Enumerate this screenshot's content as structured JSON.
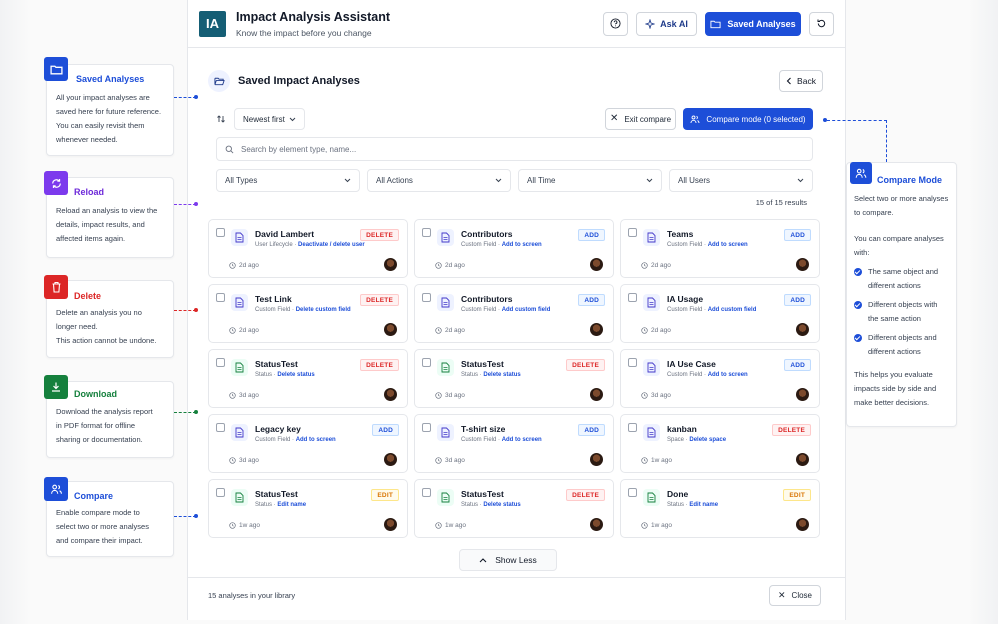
{
  "colors": {
    "primary": "#1d4ed8",
    "delete": "#dc2626",
    "download": "#15803d",
    "reload": "#7c3aed",
    "logo": "#155e75"
  },
  "header": {
    "logo_text": "IA",
    "title": "Impact Analysis Assistant",
    "subtitle": "Know the impact before you change",
    "ask_ai_label": "Ask AI",
    "saved_analyses_label": "Saved Analyses"
  },
  "panel": {
    "title": "Saved Impact Analyses",
    "back_label": "Back",
    "sort_label": "Newest first",
    "exit_compare_label": "Exit compare",
    "compare_mode_label": "Compare mode (0 selected)",
    "search_placeholder": "Search by element type, name...",
    "filters": [
      "All Types",
      "All Actions",
      "All Time",
      "All Users"
    ],
    "results_text": "15 of 15 results",
    "show_less_label": "Show Less",
    "library_text": "15 analyses in your library",
    "close_label": "Close"
  },
  "cards": [
    {
      "title": "David Lambert",
      "type": "User Lifecycle",
      "action": "Deactivate / delete user",
      "badge": "DELETE",
      "badge_kind": "delete",
      "time": "2d ago",
      "icon_color": "purple"
    },
    {
      "title": "Contributors",
      "type": "Custom Field",
      "action": "Add to screen",
      "badge": "ADD",
      "badge_kind": "add",
      "time": "2d ago",
      "icon_color": "purple"
    },
    {
      "title": "Teams",
      "type": "Custom Field",
      "action": "Add to screen",
      "badge": "ADD",
      "badge_kind": "add",
      "time": "2d ago",
      "icon_color": "purple"
    },
    {
      "title": "Test Link",
      "type": "Custom Field",
      "action": "Delete custom field",
      "badge": "DELETE",
      "badge_kind": "delete",
      "time": "2d ago",
      "icon_color": "purple"
    },
    {
      "title": "Contributors",
      "type": "Custom Field",
      "action": "Add custom field",
      "badge": "ADD",
      "badge_kind": "add",
      "time": "2d ago",
      "icon_color": "purple"
    },
    {
      "title": "IA Usage",
      "type": "Custom Field",
      "action": "Add custom field",
      "badge": "ADD",
      "badge_kind": "add",
      "time": "2d ago",
      "icon_color": "purple"
    },
    {
      "title": "StatusTest",
      "type": "Status",
      "action": "Delete status",
      "badge": "DELETE",
      "badge_kind": "delete",
      "time": "3d ago",
      "icon_color": "green"
    },
    {
      "title": "StatusTest",
      "type": "Status",
      "action": "Delete status",
      "badge": "DELETE",
      "badge_kind": "delete",
      "time": "3d ago",
      "icon_color": "green"
    },
    {
      "title": "IA Use Case",
      "type": "Custom Field",
      "action": "Add to screen",
      "badge": "ADD",
      "badge_kind": "add",
      "time": "3d ago",
      "icon_color": "purple"
    },
    {
      "title": "Legacy key",
      "type": "Custom Field",
      "action": "Add to screen",
      "badge": "ADD",
      "badge_kind": "add",
      "time": "3d ago",
      "icon_color": "purple"
    },
    {
      "title": "T-shirt size",
      "type": "Custom Field",
      "action": "Add to screen",
      "badge": "ADD",
      "badge_kind": "add",
      "time": "3d ago",
      "icon_color": "purple"
    },
    {
      "title": "kanban",
      "type": "Space",
      "action": "Delete space",
      "badge": "DELETE",
      "badge_kind": "delete",
      "time": "1w ago",
      "icon_color": "purple"
    },
    {
      "title": "StatusTest",
      "type": "Status",
      "action": "Edit name",
      "badge": "EDIT",
      "badge_kind": "edit",
      "time": "1w ago",
      "icon_color": "green"
    },
    {
      "title": "StatusTest",
      "type": "Status",
      "action": "Delete status",
      "badge": "DELETE",
      "badge_kind": "delete",
      "time": "1w ago",
      "icon_color": "green"
    },
    {
      "title": "Done",
      "type": "Status",
      "action": "Edit name",
      "badge": "EDIT",
      "badge_kind": "edit",
      "time": "1w ago",
      "icon_color": "green"
    }
  ],
  "notes": {
    "saved": {
      "title": "Saved Analyses",
      "body": [
        "All your impact analyses are",
        "saved here for future reference.",
        "You can easily revisit them",
        "whenever needed."
      ]
    },
    "reload": {
      "title": "Reload",
      "body": [
        "Reload an analysis to view the",
        "details, impact results, and",
        "affected items again."
      ]
    },
    "delete": {
      "title": "Delete",
      "body": [
        "Delete an analysis you no",
        "longer need.",
        "This action cannot be undone."
      ]
    },
    "download": {
      "title": "Download",
      "body": [
        "Download the analysis report",
        "in PDF format for offline",
        "sharing or documentation."
      ]
    },
    "compare": {
      "title": "Compare",
      "body": [
        "Enable compare mode to",
        "select two or more analyses",
        "and compare their impact."
      ]
    },
    "compare_mode": {
      "title": "Compare Mode",
      "intro": [
        "Select two or more analyses",
        "to compare."
      ],
      "lead": [
        "You can compare analyses",
        "with:"
      ],
      "items": [
        [
          "The same object and",
          "different actions"
        ],
        [
          "Different objects with",
          "the same action"
        ],
        [
          "Different objects and",
          "different actions"
        ]
      ],
      "outro": [
        "This helps you evaluate",
        "impacts side by side and",
        "make better decisions."
      ]
    }
  }
}
